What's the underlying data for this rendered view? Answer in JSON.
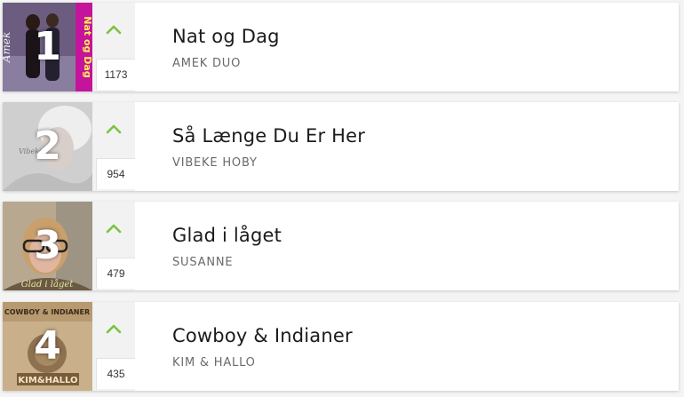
{
  "accent_color": "#7cc242",
  "entries": [
    {
      "rank": "1",
      "votes": "1173",
      "title": "Nat og Dag",
      "artist": "AMEK DUO",
      "cover_text_side": "Nat og Dag",
      "cover_text_brand": "Amek"
    },
    {
      "rank": "2",
      "votes": "954",
      "title": "Så Længe Du Er Her",
      "artist": "VIBEKE HOBY"
    },
    {
      "rank": "3",
      "votes": "479",
      "title": "Glad i låget",
      "artist": "SUSANNE",
      "cover_caption": "Glad i låget"
    },
    {
      "rank": "4",
      "votes": "435",
      "title": "Cowboy & Indianer",
      "artist": "KIM & HALLO",
      "cover_header": "COWBOY & INDIANER",
      "cover_logo": "KIM&HALLO"
    }
  ]
}
